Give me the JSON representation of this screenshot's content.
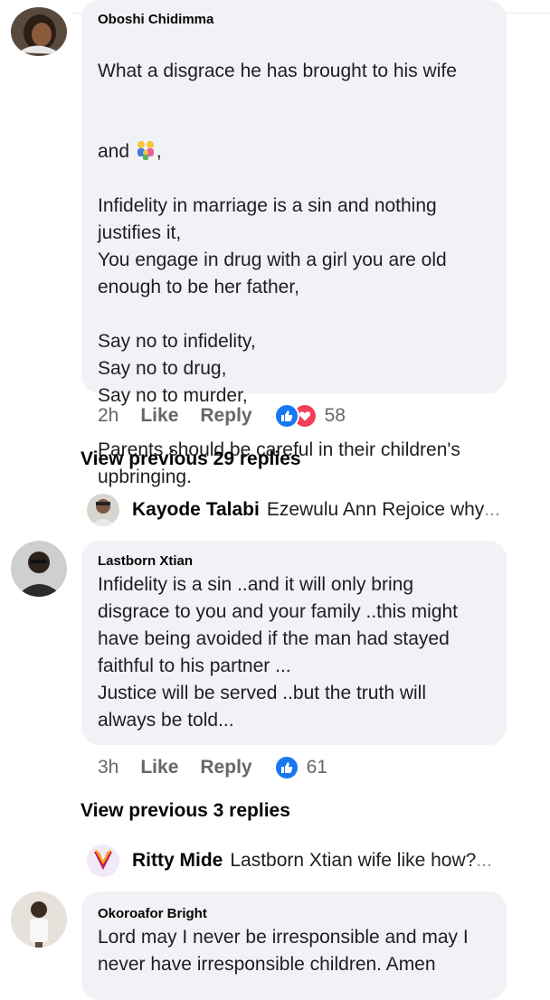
{
  "comments": [
    {
      "author": "Oboshi Chidimma",
      "text_line1": "What a disgrace he has brought to his wife",
      "text_line2_before": "and ",
      "text_line2_after": ",",
      "emoji_icon": "family-emoji",
      "text_rest": "Infidelity in marriage is a sin and nothing\njustifies it,\nYou engage in drug with a girl you are old\nenough to be her father,\n\nSay no to infidelity,\nSay no to drug,\nSay no to murder,\n\nParents should be careful in their children's\nupbringing.",
      "time": "2h",
      "like_label": "Like",
      "reply_label": "Reply",
      "reaction_icons": [
        "like-reaction-icon",
        "love-reaction-icon"
      ],
      "reaction_count": "58"
    },
    {
      "author": "Lastborn Xtian",
      "text": "Infidelity is a sin ..and it will only bring\ndisgrace to you and your family ..this might\nhave being avoided if the man had stayed\nfaithful to his partner ...\nJustice will be served ..but the truth will\nalways be told...",
      "time": "3h",
      "like_label": "Like",
      "reply_label": "Reply",
      "reaction_icons": [
        "like-reaction-icon"
      ],
      "reaction_count": "61"
    },
    {
      "author": "Okoroafor Bright",
      "text": "Lord may I never be irresponsible and may I\nnever have irresponsible children. Amen"
    }
  ],
  "view_previous": [
    {
      "label": "View previous 29 replies"
    },
    {
      "label": "View previous 3 replies"
    }
  ],
  "replies": [
    {
      "name": "Kayode Talabi",
      "text": "Ezewulu Ann Rejoice why",
      "ellipsis": "..."
    },
    {
      "name": "Ritty Mide",
      "text": "Lastborn Xtian wife like how?",
      "ellipsis": "..."
    }
  ],
  "colors": {
    "bubble": "#f0f2f5",
    "like_blue": "#1877f2",
    "love_red": "#f33e58",
    "secondary_text": "#65676b"
  }
}
